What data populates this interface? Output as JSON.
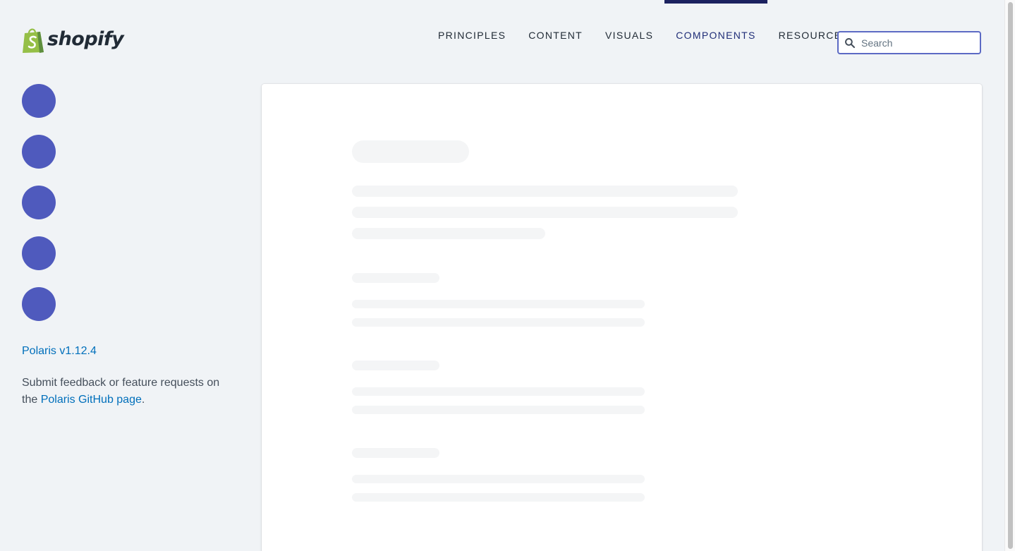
{
  "brand": {
    "name": "shopify",
    "logo_color": "#95bf47"
  },
  "nav": {
    "items": [
      {
        "label": "PRINCIPLES",
        "active": false
      },
      {
        "label": "CONTENT",
        "active": false
      },
      {
        "label": "VISUALS",
        "active": false
      },
      {
        "label": "COMPONENTS",
        "active": true
      },
      {
        "label": "RESOURCES",
        "active": false
      }
    ],
    "active_color": "#1c2260"
  },
  "search": {
    "placeholder": "Search",
    "icon": "search-icon",
    "border_color": "#5c6ac4"
  },
  "sidebar": {
    "placeholder_count": 5,
    "placeholder_color": "#4f5abd",
    "version_link": "Polaris v1.12.4",
    "feedback_prefix": "Submit feedback or feature requests on the ",
    "feedback_link": "Polaris GitHub page",
    "feedback_suffix": "."
  },
  "main": {
    "state": "loading-skeleton"
  }
}
